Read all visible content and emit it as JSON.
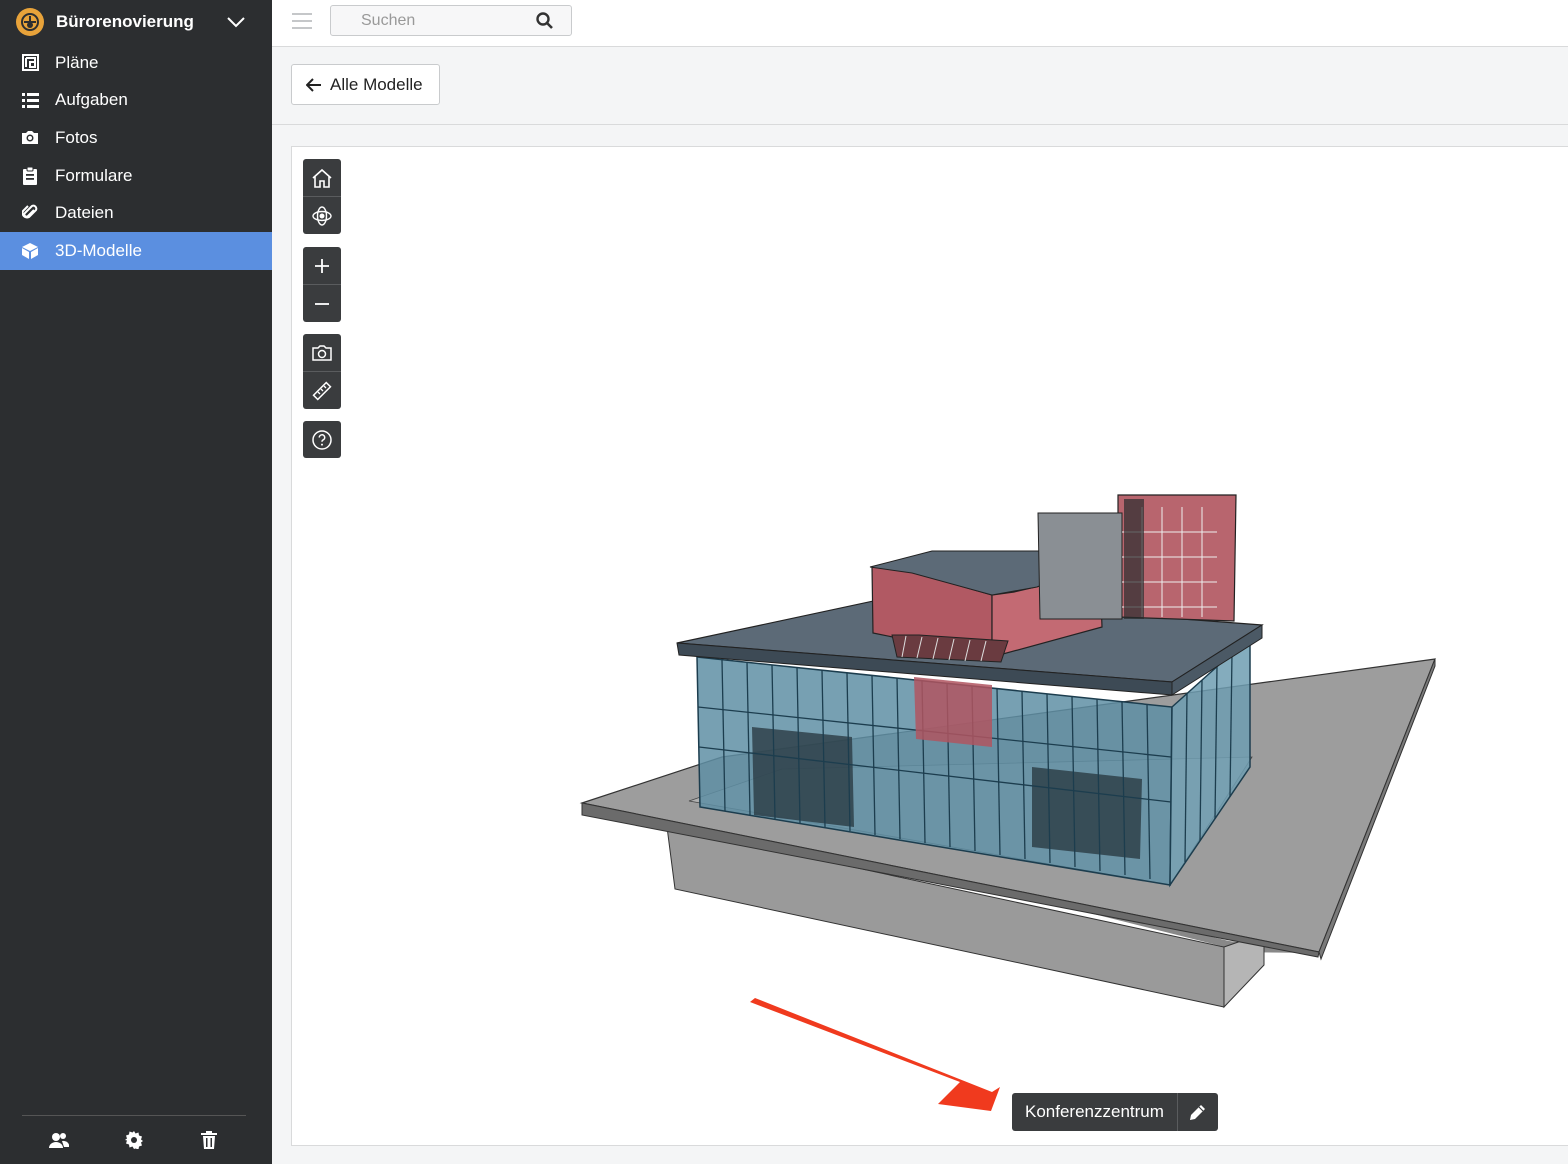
{
  "sidebar": {
    "project_name": "Bürorenovierung",
    "items": [
      {
        "label": "Pläne",
        "icon": "plans-icon"
      },
      {
        "label": "Aufgaben",
        "icon": "list-icon"
      },
      {
        "label": "Fotos",
        "icon": "camera-icon"
      },
      {
        "label": "Formulare",
        "icon": "clipboard-icon"
      },
      {
        "label": "Dateien",
        "icon": "paperclip-icon"
      },
      {
        "label": "3D-Modelle",
        "icon": "cube-icon",
        "active": true
      }
    ],
    "bottom_icons": [
      "users-icon",
      "gear-icon",
      "trash-icon"
    ]
  },
  "topbar": {
    "search_placeholder": "Suchen"
  },
  "subheader": {
    "back_label": "Alle Modelle"
  },
  "viewer": {
    "tools": [
      "home-icon",
      "orbit-icon",
      "zoom-in-icon",
      "zoom-out-icon",
      "screenshot-icon",
      "measure-icon",
      "help-icon"
    ],
    "model_name": "Konferenzzentrum"
  },
  "colors": {
    "sidebar_bg": "#2c2e30",
    "active": "#5b8fe0",
    "accent_logo": "#e8a33a",
    "annotation_arrow": "#f03a1e"
  }
}
